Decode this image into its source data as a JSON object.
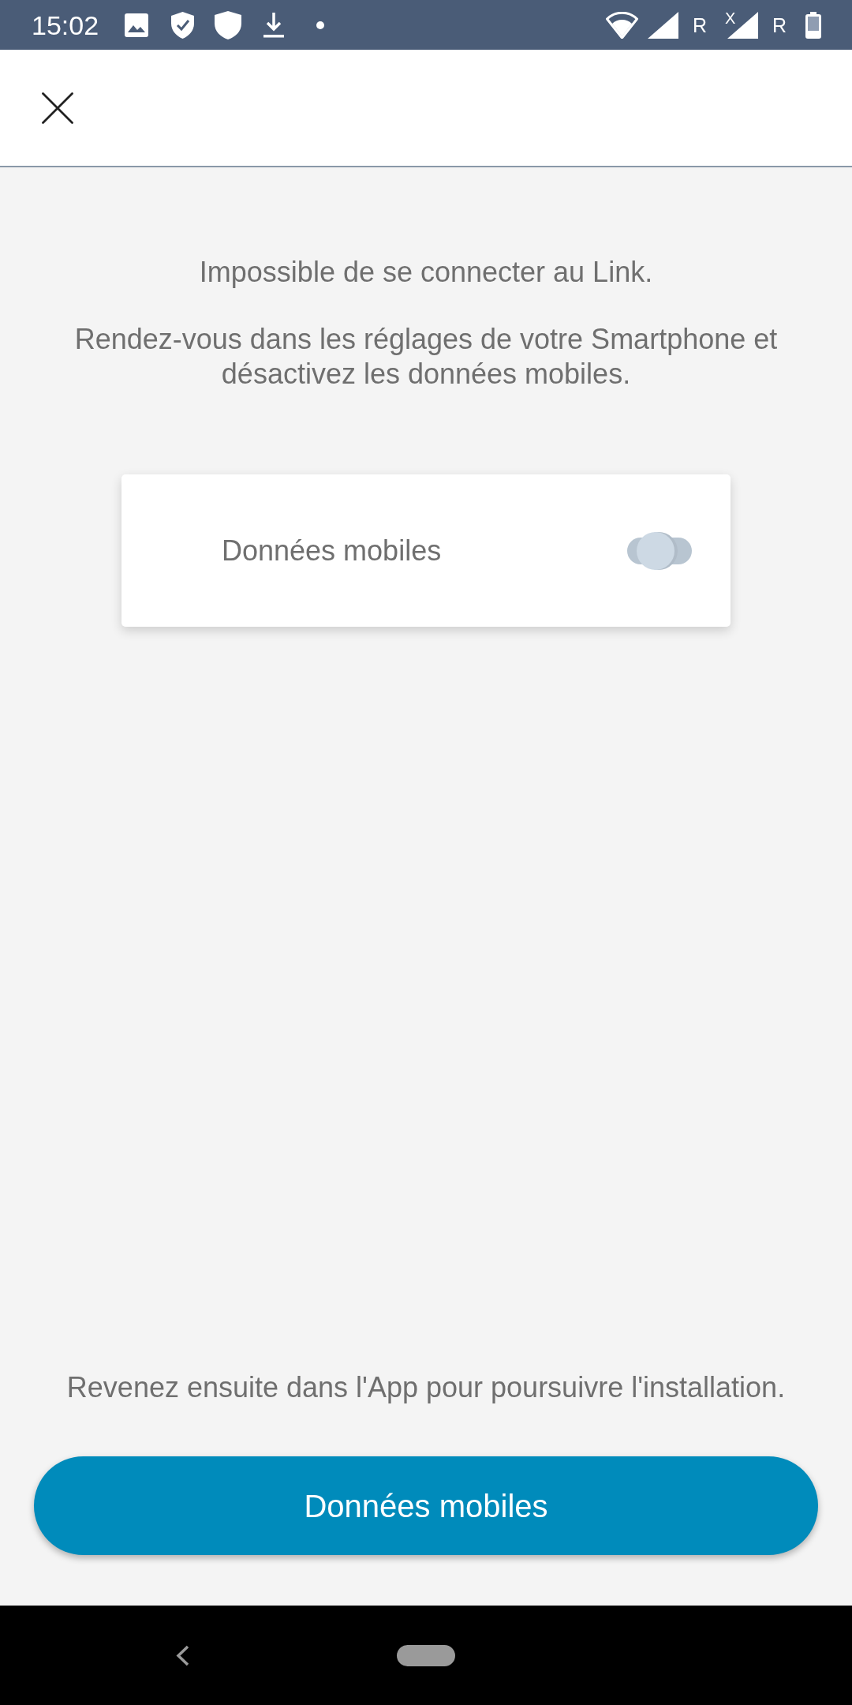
{
  "status_bar": {
    "time": "15:02",
    "signals": [
      {
        "roaming": "R"
      },
      {
        "mark": "X",
        "roaming": "R"
      }
    ]
  },
  "messages": [
    "Impossible de se connecter au Link.",
    "Rendez-vous dans les réglages de votre Smartphone et désactivez les données mobiles."
  ],
  "setting_card": {
    "label": "Données mobiles",
    "on": false
  },
  "footer_note": "Revenez ensuite dans l'App pour poursuivre l'installation.",
  "primary_button": {
    "label": "Données mobiles"
  }
}
